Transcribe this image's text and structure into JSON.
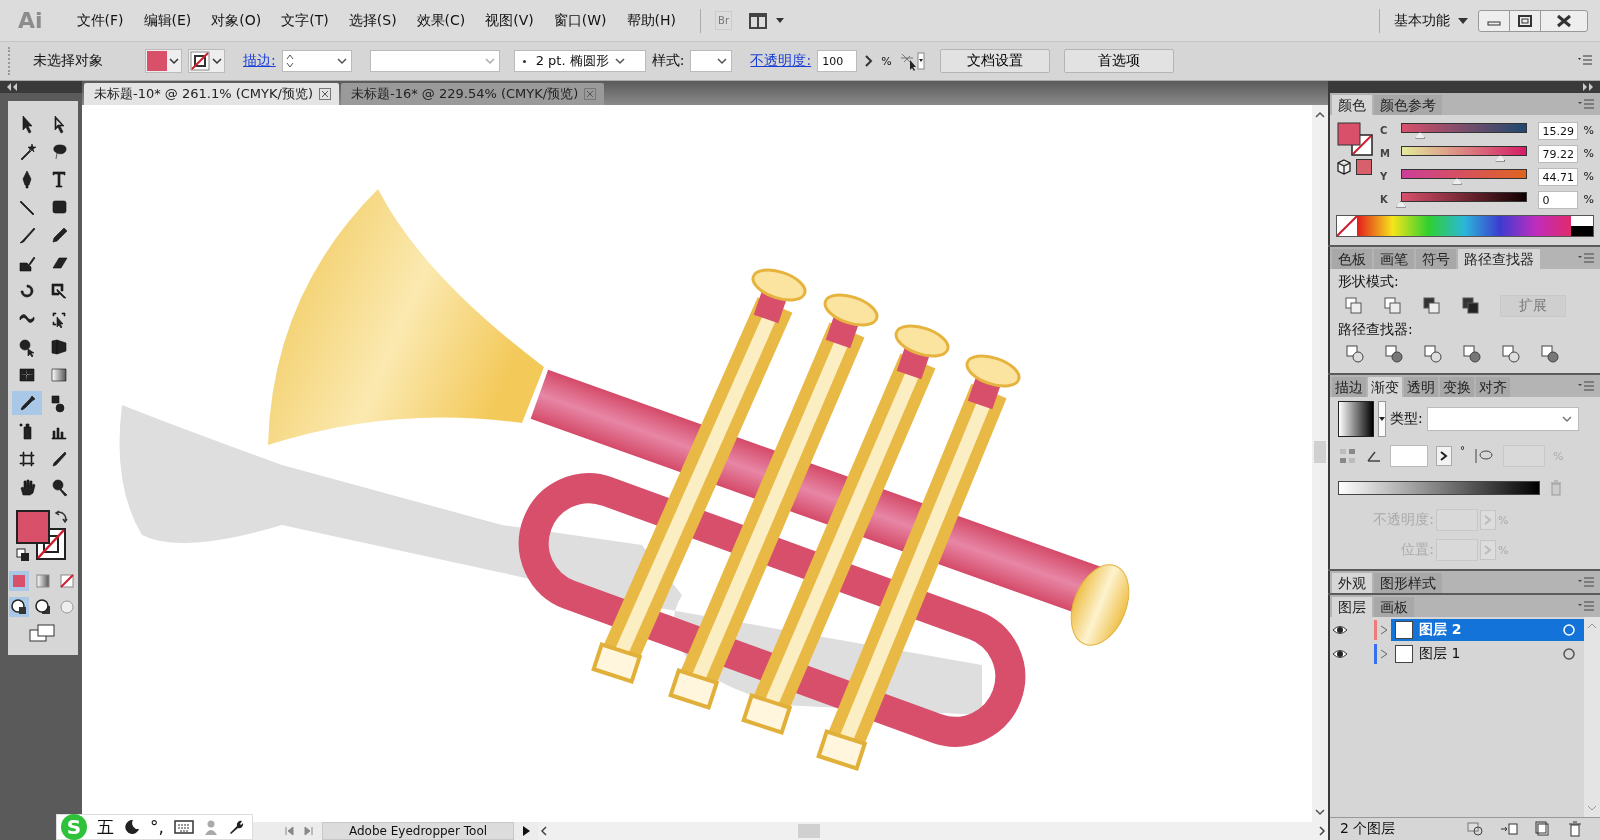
{
  "app": {
    "logo": "Ai",
    "menu": [
      "文件(F)",
      "编辑(E)",
      "对象(O)",
      "文字(T)",
      "选择(S)",
      "效果(C)",
      "视图(V)",
      "窗口(W)",
      "帮助(H)"
    ],
    "bridge": "Br",
    "workspace": "基本功能"
  },
  "control_bar": {
    "selection": "未选择对象",
    "stroke_label": "描边:",
    "brush": "2 pt. 椭圆形",
    "style_label": "样式:",
    "opacity_label": "不透明度:",
    "opacity": "100",
    "opacity_unit": "%",
    "buttons": [
      "文档设置",
      "首选项"
    ]
  },
  "doc_tabs": [
    {
      "title": "未标题-10* @ 261.1% (CMYK/预览)",
      "selected": true
    },
    {
      "title": "未标题-16* @ 229.54% (CMYK/预览)",
      "selected": false
    }
  ],
  "tools": [
    {
      "kind": "selection",
      "selected": false
    },
    {
      "kind": "direct-selection",
      "selected": false
    },
    {
      "kind": "magic-wand",
      "selected": false
    },
    {
      "kind": "lasso",
      "selected": false
    },
    {
      "kind": "pen",
      "selected": false
    },
    {
      "kind": "type",
      "selected": false
    },
    {
      "kind": "line",
      "selected": false
    },
    {
      "kind": "rectangle",
      "selected": false
    },
    {
      "kind": "paintbrush",
      "selected": false
    },
    {
      "kind": "pencil",
      "selected": false
    },
    {
      "kind": "blob-brush",
      "selected": false
    },
    {
      "kind": "eraser",
      "selected": false
    },
    {
      "kind": "rotate",
      "selected": false
    },
    {
      "kind": "scale",
      "selected": false
    },
    {
      "kind": "warp",
      "selected": false
    },
    {
      "kind": "free-transform",
      "selected": false
    },
    {
      "kind": "shape-builder",
      "selected": false
    },
    {
      "kind": "perspective-grid",
      "selected": false
    },
    {
      "kind": "mesh",
      "selected": false
    },
    {
      "kind": "gradient",
      "selected": false
    },
    {
      "kind": "eyedropper",
      "selected": true
    },
    {
      "kind": "blend",
      "selected": false
    },
    {
      "kind": "symbol-sprayer",
      "selected": false
    },
    {
      "kind": "graph",
      "selected": false
    },
    {
      "kind": "artboard",
      "selected": false
    },
    {
      "kind": "slice",
      "selected": false
    },
    {
      "kind": "hand",
      "selected": false
    },
    {
      "kind": "zoom",
      "selected": false
    }
  ],
  "color_panel": {
    "tabs": [
      {
        "label": "颜色",
        "selected": true
      },
      {
        "label": "颜色参考",
        "selected": false
      }
    ],
    "channels": [
      {
        "name": "C",
        "value": "15.29",
        "unit": "%",
        "level": 0.1529
      },
      {
        "name": "M",
        "value": "79.22",
        "unit": "%",
        "level": 0.7922
      },
      {
        "name": "Y",
        "value": "44.71",
        "unit": "%",
        "level": 0.4471
      },
      {
        "name": "K",
        "value": "0",
        "unit": "%",
        "level": 0
      }
    ]
  },
  "pathfinder_panel": {
    "tabs": [
      {
        "label": "色板",
        "selected": false
      },
      {
        "label": "画笔",
        "selected": false
      },
      {
        "label": "符号",
        "selected": false
      },
      {
        "label": "路径查找器",
        "selected": true
      }
    ],
    "shape_modes_label": "形状模式:",
    "expand_button": "扩展",
    "pathfinders_label": "路径查找器:"
  },
  "gradient_panel": {
    "tabs": [
      {
        "label": "描边",
        "selected": false
      },
      {
        "label": "渐变",
        "selected": true
      },
      {
        "label": "透明",
        "selected": false
      },
      {
        "label": "变换",
        "selected": false
      },
      {
        "label": "对齐",
        "selected": false
      }
    ],
    "type_label": "类型:",
    "angle_unit": "°",
    "aspect_unit": "%",
    "opacity_label": "不透明度:",
    "opacity_unit": "%",
    "location_label": "位置:",
    "location_unit": "%"
  },
  "appearance_panel": {
    "tabs": [
      {
        "label": "外观",
        "selected": true
      },
      {
        "label": "图形样式",
        "selected": false
      }
    ]
  },
  "layers_panel": {
    "tabs": [
      {
        "label": "图层",
        "selected": true
      },
      {
        "label": "画板",
        "selected": false
      }
    ],
    "layers": [
      {
        "name": "图层 2",
        "selected": true
      },
      {
        "name": "图层 1",
        "selected": false
      }
    ],
    "count": "2 个图层"
  },
  "status_bar": {
    "tool": "Adobe Eyedropper Tool"
  },
  "ime_bar": {
    "logo": "S",
    "input_mode": "五",
    "punctuation": "°,"
  }
}
